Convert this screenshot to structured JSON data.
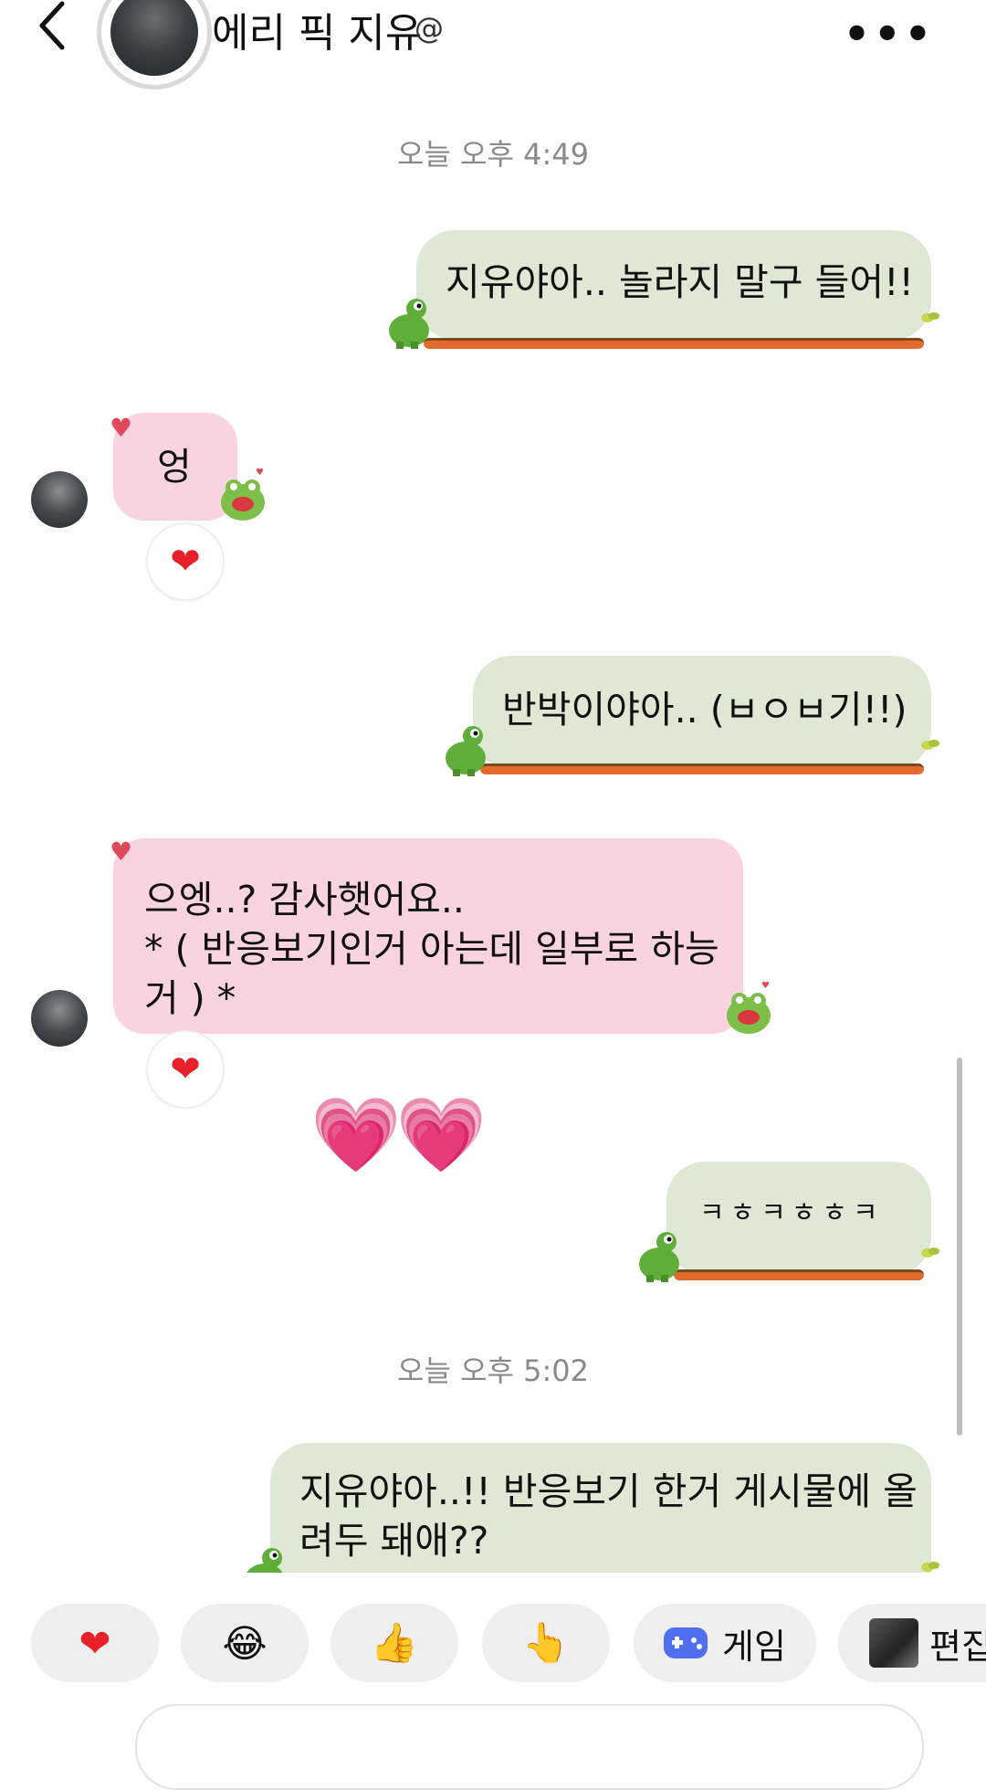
{
  "header": {
    "title": "에리 픽 지유",
    "threads_icon": "@",
    "more": "•••"
  },
  "timestamps": [
    "오늘 오후 4:49",
    "오늘 오후 5:02"
  ],
  "messages": [
    {
      "side": "sent",
      "text": "지유야아.. 놀라지 말구 들어!!"
    },
    {
      "side": "recv",
      "text": "엉",
      "reaction": "❤"
    },
    {
      "side": "sent",
      "text": "반박이야아.. (ㅂㅇㅂ기!!)"
    },
    {
      "side": "recv",
      "text": "으엥..? 감사햇어요..\n* ( 반응보기인거 아는데 일부로 하능\n거 ) *",
      "reaction": "❤"
    },
    {
      "side": "recv_emoji",
      "text": "💗💗"
    },
    {
      "side": "sent",
      "text": "ㅋㅎㅋㅎㅎㅋ"
    },
    {
      "side": "sent",
      "text": "지유야아..!! 반응보기 한거 게시물에 올\n려두 돼애??"
    }
  ],
  "quick_replies": [
    {
      "emoji": "❤"
    },
    {
      "emoji": "😂"
    },
    {
      "emoji": "👍"
    },
    {
      "emoji": "👆"
    },
    {
      "icon": "game-icon",
      "label": "게임"
    },
    {
      "icon": "photo-thumbnail",
      "label": "편집"
    }
  ],
  "colors": {
    "sent_bubble": "#dfe8d4",
    "recv_bubble": "#f9d3e0",
    "tongue": "#e26a2c",
    "frog": "#5fae3a",
    "heart": "#e8202a",
    "pink_heart": "#ff2fb8",
    "timestamp": "#8a8a8a"
  }
}
